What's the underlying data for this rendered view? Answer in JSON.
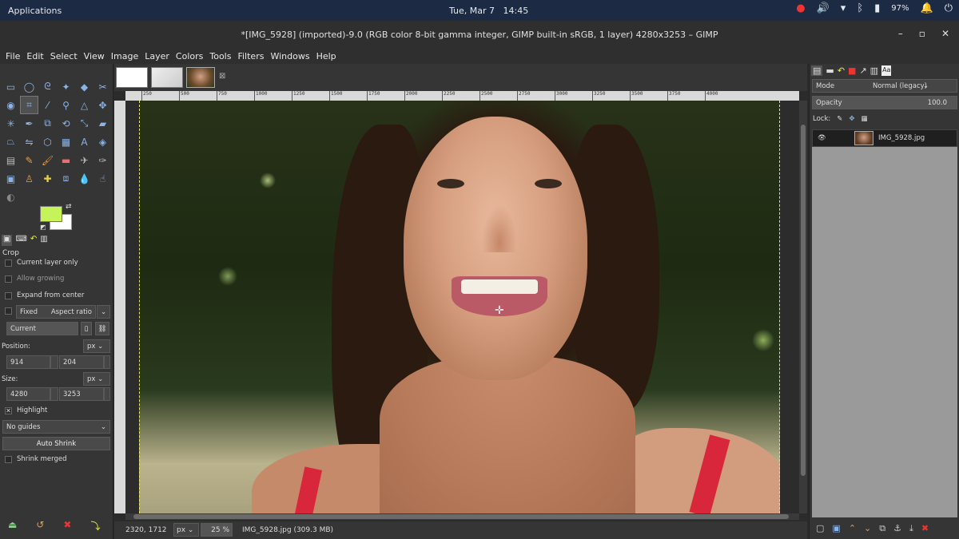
{
  "topbar": {
    "apps_label": "Applications",
    "date": "Tue, Mar 7",
    "time": "14:45",
    "battery": "97%"
  },
  "window": {
    "title": "*[IMG_5928] (imported)-9.0 (RGB color 8-bit gamma integer, GIMP built-in sRGB, 1 layer) 4280x3253 – GIMP",
    "min": "–",
    "max": "▫",
    "close": "✕"
  },
  "menu": [
    "File",
    "Edit",
    "Select",
    "View",
    "Image",
    "Layer",
    "Colors",
    "Tools",
    "Filters",
    "Windows",
    "Help"
  ],
  "tool_options": {
    "title": "Crop",
    "current_layer_only": "Current layer only",
    "allow_growing": "Allow growing",
    "expand_from_center": "Expand from center",
    "fixed": "Fixed",
    "aspect_ratio": "Aspect ratio",
    "current": "Current",
    "position_label": "Position:",
    "position_unit": "px",
    "position_x": "914",
    "position_y": "204",
    "size_label": "Size:",
    "size_unit": "px",
    "size_w": "4280",
    "size_h": "3253",
    "highlight": "Highlight",
    "guides": "No guides",
    "auto_shrink": "Auto Shrink",
    "shrink_merged": "Shrink merged"
  },
  "ruler_ticks": [
    "250",
    "500",
    "750",
    "1000",
    "1250",
    "1500",
    "1750",
    "2000",
    "2250",
    "2500",
    "2750",
    "3000",
    "3250",
    "3500",
    "3750",
    "4000"
  ],
  "status": {
    "coords": "2320, 1712",
    "unit": "px",
    "zoom": "25 %",
    "file_info": "IMG_5928.jpg (309.3 MB)"
  },
  "layers": {
    "mode_label": "Mode",
    "mode_value": "Normal (legacy)",
    "opacity_label": "Opacity",
    "opacity_value": "100.0",
    "lock_label": "Lock:",
    "layer_name": "IMG_5928.jpg"
  },
  "colors": {
    "foreground": "#c6f25a",
    "background": "#ffffff",
    "accent_red": "#d8263a"
  }
}
